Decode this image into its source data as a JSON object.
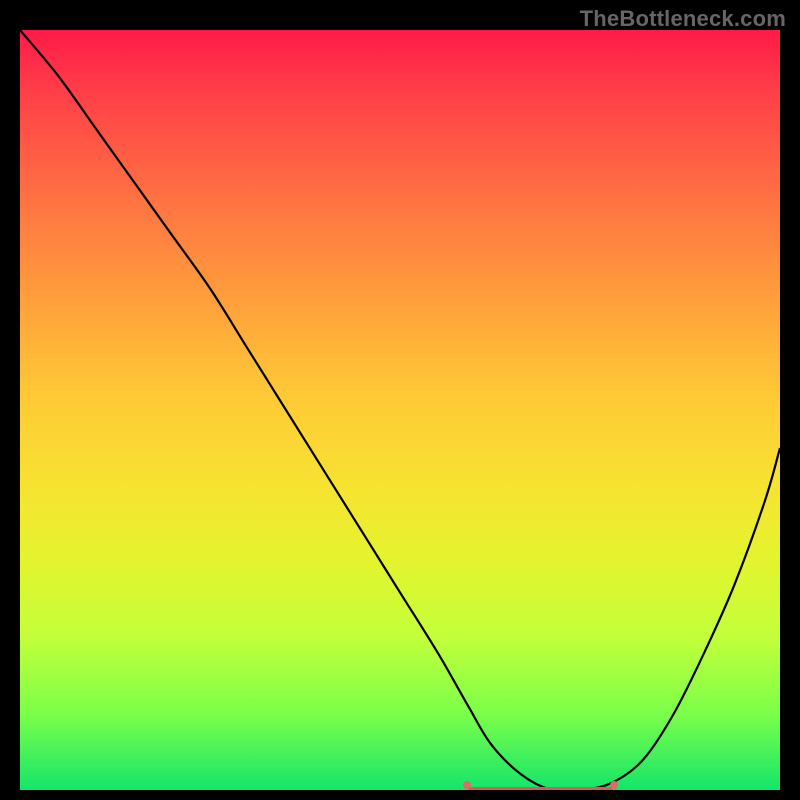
{
  "watermark": "TheBottleneck.com",
  "colors": {
    "page_bg": "#000000",
    "watermark": "#666666",
    "curve": "#000000",
    "flat_marker": "#da5a5a",
    "gradient_top": "#ff1a47",
    "gradient_bottom": "#14e56a"
  },
  "chart_data": {
    "type": "line",
    "title": "",
    "xlabel": "",
    "ylabel": "",
    "xlim": [
      0,
      100
    ],
    "ylim": [
      0,
      100
    ],
    "x": [
      0,
      5,
      10,
      15,
      20,
      25,
      30,
      35,
      40,
      45,
      50,
      55,
      59,
      62,
      66,
      70,
      74,
      78,
      82,
      86,
      90,
      94,
      98,
      100
    ],
    "y": [
      100,
      94,
      87,
      80,
      73,
      66,
      58,
      50,
      42,
      34,
      26,
      18,
      11,
      6,
      2,
      0,
      0,
      1,
      4,
      10,
      18,
      27,
      38,
      45
    ],
    "annotations": [
      {
        "label": "optimum_flat_region",
        "x_start": 59,
        "x_end": 78,
        "y": 0
      }
    ]
  }
}
